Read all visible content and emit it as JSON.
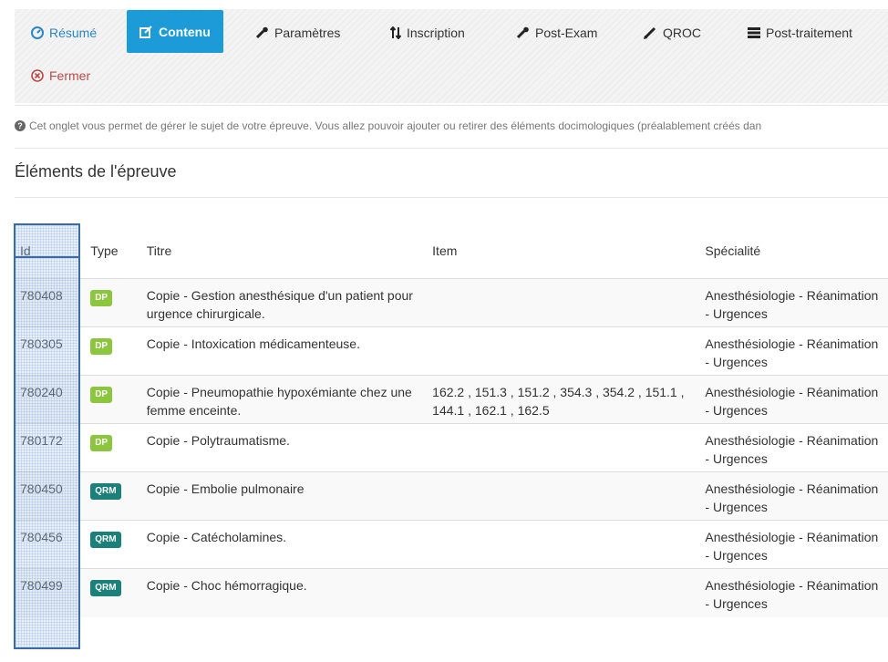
{
  "tabs": [
    {
      "key": "resume",
      "label": "Résumé",
      "icon": "dashboard-icon",
      "state": "link"
    },
    {
      "key": "contenu",
      "label": "Contenu",
      "icon": "edit-icon",
      "state": "active"
    },
    {
      "key": "parametres",
      "label": "Paramètres",
      "icon": "wrench-icon",
      "state": "normal"
    },
    {
      "key": "inscription",
      "label": "Inscription",
      "icon": "sort-icon",
      "state": "normal"
    },
    {
      "key": "post-exam",
      "label": "Post-Exam",
      "icon": "wrench-icon",
      "state": "normal"
    },
    {
      "key": "qroc",
      "label": "QROC",
      "icon": "pencil-icon",
      "state": "normal"
    },
    {
      "key": "post-traitement",
      "label": "Post-traitement",
      "icon": "server-icon",
      "state": "normal"
    },
    {
      "key": "fermer",
      "label": "Fermer",
      "icon": "close-circle-icon",
      "state": "danger"
    }
  ],
  "info": {
    "icon": "question-circle-icon",
    "text": "Cet onglet vous permet de gérer le sujet de votre épreuve. Vous allez pouvoir ajouter ou retirer des éléments docimologiques (préalablement créés dan"
  },
  "section_title": "Éléments de l'épreuve",
  "table": {
    "headers": {
      "id": "Id",
      "type": "Type",
      "title": "Titre",
      "item": "Item",
      "specialty": "Spécialité"
    },
    "rows": [
      {
        "id": "780408",
        "type": "DP",
        "title": "Copie - Gestion anesthésique d'un patient pour urgence chirurgicale.",
        "item": "",
        "specialty": "Anesthésiologie - Réanimation - Urgences"
      },
      {
        "id": "780305",
        "type": "DP",
        "title": "Copie - Intoxication médicamenteuse.",
        "item": "",
        "specialty": "Anesthésiologie - Réanimation - Urgences"
      },
      {
        "id": "780240",
        "type": "DP",
        "title": "Copie - Pneumopathie hypoxémiante chez une femme enceinte.",
        "item": "162.2 , 151.3 , 151.2 , 354.3 , 354.2 , 151.1 , 144.1 , 162.1 , 162.5",
        "specialty": "Anesthésiologie - Réanimation - Urgences"
      },
      {
        "id": "780172",
        "type": "DP",
        "title": "Copie - Polytraumatisme.",
        "item": "",
        "specialty": "Anesthésiologie - Réanimation - Urgences"
      },
      {
        "id": "780450",
        "type": "QRM",
        "title": "Copie - Embolie pulmonaire",
        "item": "",
        "specialty": "Anesthésiologie - Réanimation - Urgences"
      },
      {
        "id": "780456",
        "type": "QRM",
        "title": "Copie - Catécholamines.",
        "item": "",
        "specialty": "Anesthésiologie - Réanimation - Urgences"
      },
      {
        "id": "780499",
        "type": "QRM",
        "title": "Copie - Choc hémorragique.",
        "item": "",
        "specialty": "Anesthésiologie - Réanimation - Urgences"
      }
    ]
  },
  "colors": {
    "active_tab": "#1d9bd8",
    "link": "#2a87c6",
    "danger": "#b94a48",
    "badge_dp": "#8cc63f",
    "badge_qrm": "#1b7f7a",
    "highlight_border": "#3a6aa8"
  }
}
